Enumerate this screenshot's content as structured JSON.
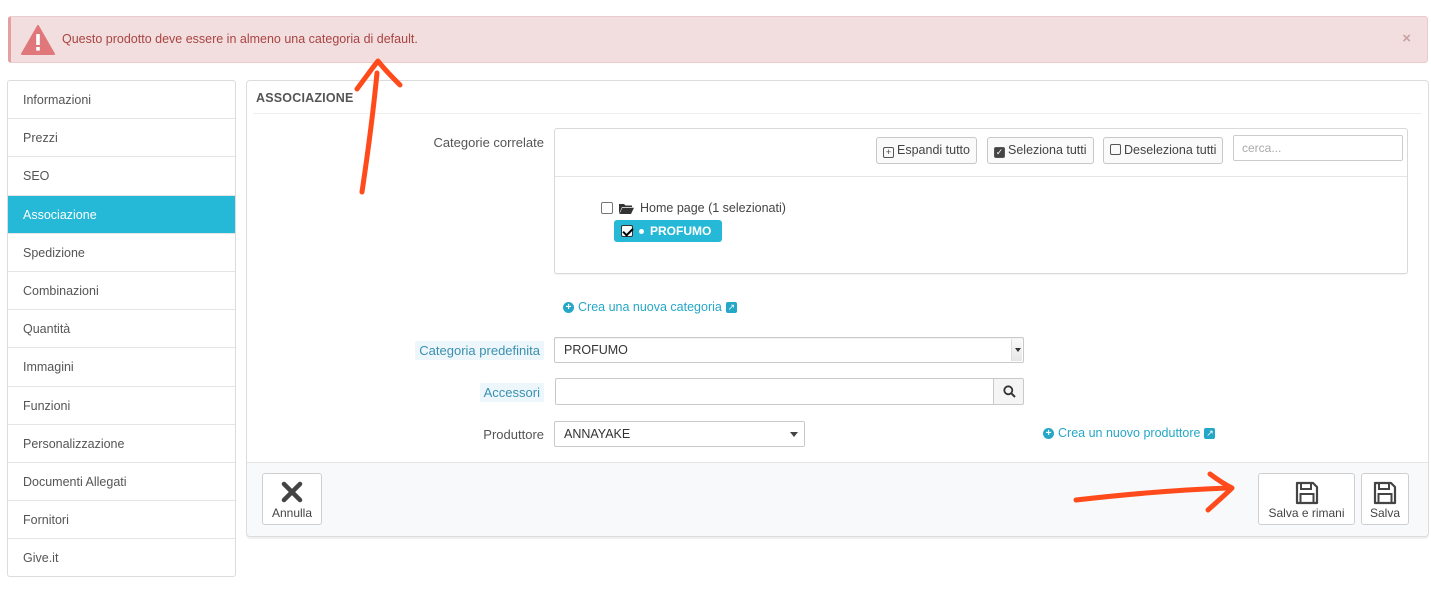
{
  "alert": {
    "message": "Questo prodotto deve essere in almeno una categoria di default.",
    "close": "×"
  },
  "sidebar": {
    "items": [
      {
        "label": "Informazioni",
        "active": false
      },
      {
        "label": "Prezzi",
        "active": false
      },
      {
        "label": "SEO",
        "active": false
      },
      {
        "label": "Associazione",
        "active": true
      },
      {
        "label": "Spedizione",
        "active": false
      },
      {
        "label": "Combinazioni",
        "active": false
      },
      {
        "label": "Quantità",
        "active": false
      },
      {
        "label": "Immagini",
        "active": false
      },
      {
        "label": "Funzioni",
        "active": false
      },
      {
        "label": "Personalizzazione",
        "active": false
      },
      {
        "label": "Documenti Allegati",
        "active": false
      },
      {
        "label": "Fornitori",
        "active": false
      },
      {
        "label": "Give.it",
        "active": false
      }
    ]
  },
  "panel": {
    "title": "ASSOCIAZIONE",
    "related_categories_label": "Categorie correlate",
    "tree": {
      "expand_all": "Espandi tutto",
      "select_all": "Seleziona tutti",
      "deselect_all": "Deseleziona tutti",
      "search_placeholder": "cerca...",
      "root_label": "Home page (1 selezionati)",
      "child_label": "PROFUMO"
    },
    "new_category_link": "Crea una nuova categoria",
    "default_category_label": "Categoria predefinita",
    "default_category_value": "PROFUMO",
    "accessories_label": "Accessori",
    "accessories_value": "",
    "manufacturer_label": "Produttore",
    "manufacturer_value": "ANNAYAKE",
    "new_manufacturer_link": "Crea un nuovo produttore",
    "cancel_label": "Annulla",
    "save_stay_label": "Salva e rimani",
    "save_label": "Salva"
  },
  "colors": {
    "accent": "#25b9d7",
    "alert_bg": "#f2dedf",
    "alert_text": "#a94442",
    "annotation_arrow": "#ff4a1c"
  }
}
